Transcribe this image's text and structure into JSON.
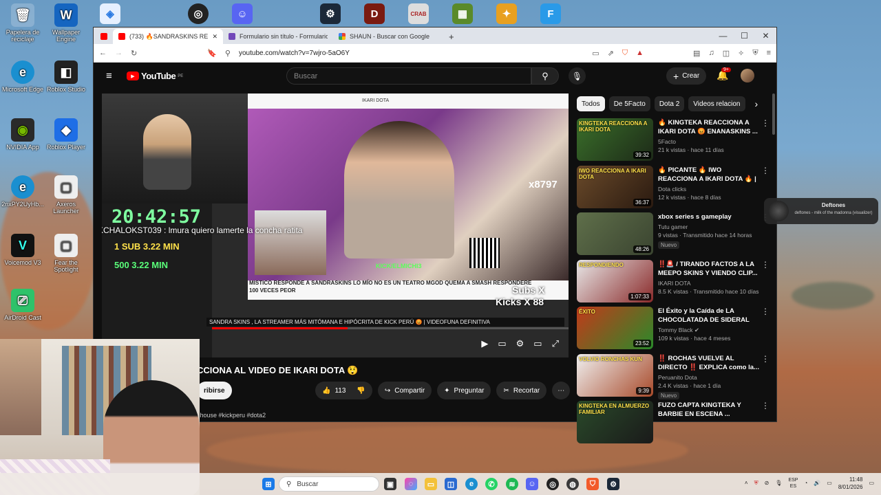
{
  "desktop": {
    "icons": [
      {
        "label": "Papelera de reciclaje",
        "icon": "recycle-bin-icon"
      },
      {
        "label": "Wallpaper Engine",
        "icon": "wallpaper-engine-icon"
      },
      {
        "label": "Microsoft Edge",
        "icon": "edge-icon"
      },
      {
        "label": "Roblox Studio",
        "icon": "roblox-studio-icon"
      },
      {
        "label": "NVIDIA App",
        "icon": "nvidia-icon"
      },
      {
        "label": "Roblox Player",
        "icon": "roblox-icon"
      },
      {
        "label": "2nxPY2UyHb...",
        "icon": "edge-shortcut-icon"
      },
      {
        "label": "Axeros Launcher",
        "icon": "launcher-icon"
      },
      {
        "label": "Voicemod V3",
        "icon": "voicemod-icon"
      },
      {
        "label": "Fear the Spotlight",
        "icon": "game-icon"
      },
      {
        "label": "AirDroid Cast",
        "icon": "airdroid-icon"
      }
    ]
  },
  "browser": {
    "tabs": [
      {
        "label": "(733) 🔥SANDRASKINS REACCIO",
        "active": true
      },
      {
        "label": "Formulario sin título - Formularios de",
        "active": false
      },
      {
        "label": "SHAUN - Buscar con Google",
        "active": false
      }
    ],
    "url": "youtube.com/watch?v=7wjro-5aO6Y"
  },
  "youtube": {
    "logo": "YouTube",
    "region": "PE",
    "search_placeholder": "Buscar",
    "create_label": "Crear",
    "notif_count": "9+",
    "chips": [
      "Todos",
      "De 5Facto",
      "Dota 2",
      "Videos relacion"
    ],
    "video_title": "CCIONA AL VIDEO DE IKARI DOTA 😲",
    "subscribe_label": "ribirse",
    "like_count": "113",
    "share_label": "Compartir",
    "ask_label": "Preguntar",
    "clip_label": "Recortar",
    "hashtags": "shouse #kickperu #dota2",
    "player": {
      "timer": "20:42:57",
      "chat_line": "KCHALOKST039 : lmura quiero lamerte la concha ratita",
      "sub1": "1 SUB  3.22 MIN",
      "sub2": "500  3.22 MIN",
      "subs_x": "Subs X",
      "kicks_x": "Kicks X 88",
      "inner_search": "IKARI DOTA",
      "inner_caption": "MISTICO RESPONDE A SANDRASKINS LO MÍO NO ES UN TEATRO MGOD QUEMA A SMASH RESPONDERE 100 VECES PEOR",
      "inner_title": "SANDRA SKINS , LA STREAMER MÁS MITÓMANA E HIPÓCRITA DE KICK PERÚ 😡 | VIDEOFUNA DEFINITIVA",
      "kick_tag": "KICK/ELMICHI3",
      "counter": "x8797"
    },
    "recommendations": [
      {
        "title": "🔥 KINGTEKA REACCIONA A IKARI DOTA 😡 ENANASKINS ...",
        "channel": "5Facto",
        "meta": "21 k vistas · hace 11 días",
        "duration": "39:32",
        "thumb_text": "KINGTEKA REACCIONA A IKARI DOTA",
        "colors": [
          "#3a6f2a",
          "#1d2a18"
        ],
        "new": ""
      },
      {
        "title": "🔥 PICANTE 🔥 IWO REACCIONA A IKARI DOTA 🔥 | ...",
        "channel": "Dota clicks",
        "meta": "12 k vistas · hace 8 días",
        "duration": "36:37",
        "thumb_text": "IWO REACCIONA A IKARI DOTA",
        "colors": [
          "#6a4a2a",
          "#2a1a10"
        ],
        "new": ""
      },
      {
        "title": "xbox series s gameplay",
        "channel": "Tutu gamer",
        "meta": "9 vistas · Transmitido hace 14 horas",
        "duration": "48:26",
        "thumb_text": "",
        "colors": [
          "#5f6f4a",
          "#3a4430"
        ],
        "new": "Nuevo"
      },
      {
        "title": "‼️🚨 / TIRANDO FACTOS A LA MEEPO SKINS Y VIENDO CLIP...",
        "channel": "IKARI DOTA",
        "meta": "8.5 K vistas · Transmitido hace 10 días",
        "duration": "1:07:33",
        "thumb_text": "RESPONDIENDO",
        "colors": [
          "#e8e8e8",
          "#8a2a2a"
        ],
        "new": ""
      },
      {
        "title": "El Éxito y la Caída de LA CHOCOLATADA DE SIDERAL",
        "channel": "Tommy Black ✔",
        "meta": "109 k vistas · hace 4 meses",
        "duration": "23:52",
        "thumb_text": "ÉXITO",
        "colors": [
          "#c23a1a",
          "#2a8a2a"
        ],
        "new": ""
      },
      {
        "title": "‼️ ROCHAS VUELVE AL DIRECTO ‼️ EXPLICA como la...",
        "channel": "Peruanito Dota",
        "meta": "2.4 K vistas · hace 1 día",
        "duration": "9:39",
        "thumb_text": "VOLVIO RONCHAS KUN",
        "colors": [
          "#f0f0f0",
          "#a84a2a"
        ],
        "new": "Nuevo"
      },
      {
        "title": "FUZO CAPTA KINGTEKA Y BARBIE EN ESCENA ...",
        "channel": "",
        "meta": "",
        "duration": "",
        "thumb_text": "KINGTEKA EN ALMUERZO FAMILIAR",
        "colors": [
          "#2a4a2a",
          "#1a1a1a"
        ],
        "new": ""
      }
    ]
  },
  "notification": {
    "title": "Deftones",
    "text": "deftones - milk of the madonna (visualizer)"
  },
  "taskbar": {
    "search_placeholder": "Buscar",
    "lang": "ESP\nES",
    "time": "11:48",
    "date": "8/01/2026"
  }
}
